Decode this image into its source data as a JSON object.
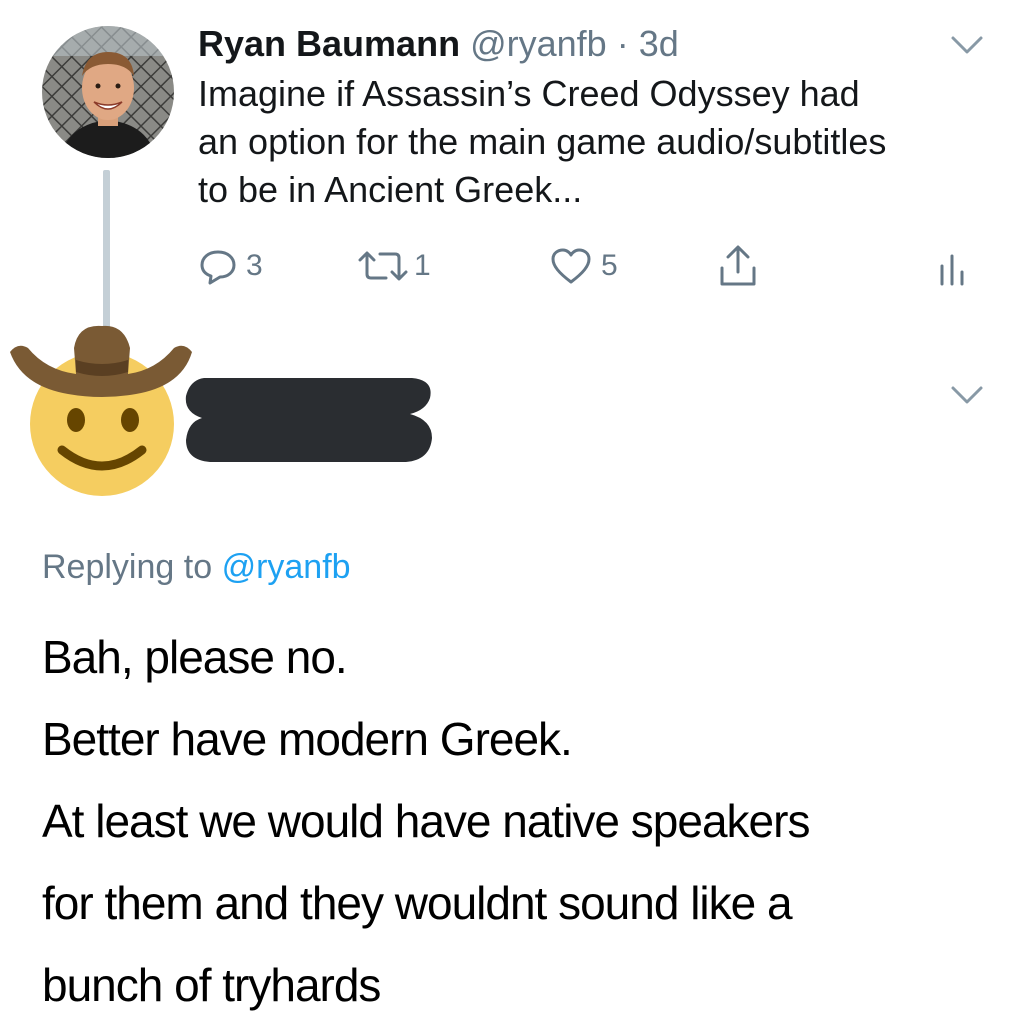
{
  "original_tweet": {
    "author_name": "Ryan Baumann",
    "author_handle": "@ryanfb",
    "separator": "·",
    "timestamp": "3d",
    "text_lines": [
      "Imagine if Assassin’s Creed Odyssey had",
      "an option for the main game audio/subtitles",
      "to be in Ancient Greek..."
    ],
    "actions": {
      "reply_count": "3",
      "retweet_count": "1",
      "like_count": "5"
    },
    "icons": [
      "reply-icon",
      "retweet-icon",
      "like-icon",
      "share-icon",
      "analytics-icon",
      "chevron-down-icon"
    ]
  },
  "reply_tweet": {
    "avatar_emoji": "cowboy-hat-face",
    "author_redacted": true,
    "replying_prefix": "Replying to",
    "replying_mention": "@ryanfb",
    "text_lines": [
      "Bah, please no.",
      "Better have modern Greek.",
      "At least we would have native speakers",
      "for them and they wouldnt sound like a",
      "bunch of tryhards"
    ]
  },
  "colors": {
    "text": "#14171a",
    "secondary": "#657786",
    "link": "#1da1f2",
    "thread_line": "#c4cfd6",
    "redaction": "#2a2d31"
  }
}
